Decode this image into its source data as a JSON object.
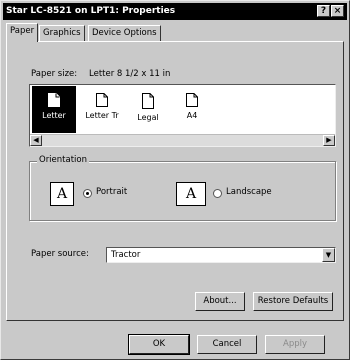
{
  "window": {
    "title": "Star LC-8521 on LPT1: Properties",
    "help_button": "?",
    "close_button": "×"
  },
  "tabs": [
    {
      "label": "Paper",
      "active": true
    },
    {
      "label": "Graphics",
      "active": false
    },
    {
      "label": "Device Options",
      "active": false
    }
  ],
  "paper": {
    "size_label": "Paper size:",
    "size_value": "Letter 8 1/2 x 11 in",
    "sizes": [
      {
        "label": "Letter",
        "selected": true,
        "icon": "page-icon"
      },
      {
        "label": "Letter Tr",
        "selected": false,
        "icon": "page-icon"
      },
      {
        "label": "Legal",
        "selected": false,
        "icon": "page-icon"
      },
      {
        "label": "A4",
        "selected": false,
        "icon": "page-icon"
      }
    ]
  },
  "orientation": {
    "group_label": "Orientation",
    "portrait_label": "Portrait",
    "landscape_label": "Landscape",
    "icon_letter": "A",
    "selected": "portrait"
  },
  "source": {
    "label": "Paper source:",
    "value": "Tractor"
  },
  "buttons": {
    "about": "About...",
    "restore": "Restore Defaults",
    "ok": "OK",
    "cancel": "Cancel",
    "apply": "Apply"
  },
  "colors": {
    "face": "#c9c9c9",
    "titlebar": "#000000",
    "selection": "#000000"
  }
}
